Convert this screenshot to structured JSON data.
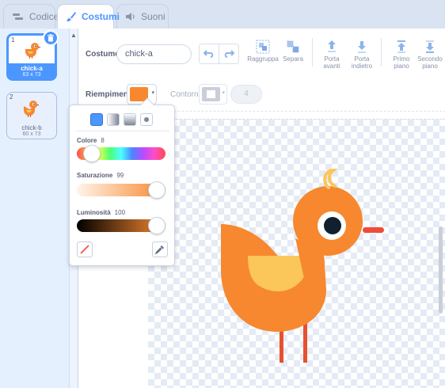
{
  "tabs": [
    {
      "label": "Codice",
      "icon": "code-icon"
    },
    {
      "label": "Costumi",
      "icon": "paintbrush-icon",
      "active": true
    },
    {
      "label": "Suoni",
      "icon": "speaker-icon"
    }
  ],
  "costumes": [
    {
      "number": "1",
      "name": "chick-a",
      "size": "63 x 73",
      "selected": true
    },
    {
      "number": "2",
      "name": "chick-b",
      "size": "60 x 73"
    }
  ],
  "toolbar": {
    "costume_label": "Costume",
    "costume_name": "chick-a",
    "undo_icon": "undo-icon",
    "redo_icon": "redo-icon",
    "group_label": "Raggruppa",
    "ungroup_label": "Separa",
    "forward_label_1": "Porta",
    "forward_label_2": "avanti",
    "backward_label_1": "Porta",
    "backward_label_2": "indietro",
    "front_label_1": "Primo",
    "front_label_2": "piano",
    "back_label_1": "Secondo",
    "back_label_2": "piano"
  },
  "fill": {
    "fill_label": "Riempimento",
    "fill_color": "#f7882f",
    "outline_label": "Contorno",
    "outline_color": "#c9ced8",
    "outline_width": "4"
  },
  "color_picker": {
    "color_label": "Colore",
    "color_value": "8",
    "saturation_label": "Saturazione",
    "saturation_value": "99",
    "brightness_label": "Luminosità",
    "brightness_value": "100",
    "no_color_icon": "no-color-icon",
    "eyedropper_icon": "eyedropper-icon"
  },
  "colors": {
    "accent": "#4c97ff",
    "chick_orange": "#f7882f",
    "wing_yellow": "#fbc65a",
    "beak_red": "#ef4b3b",
    "legs_red": "#e8502e"
  }
}
